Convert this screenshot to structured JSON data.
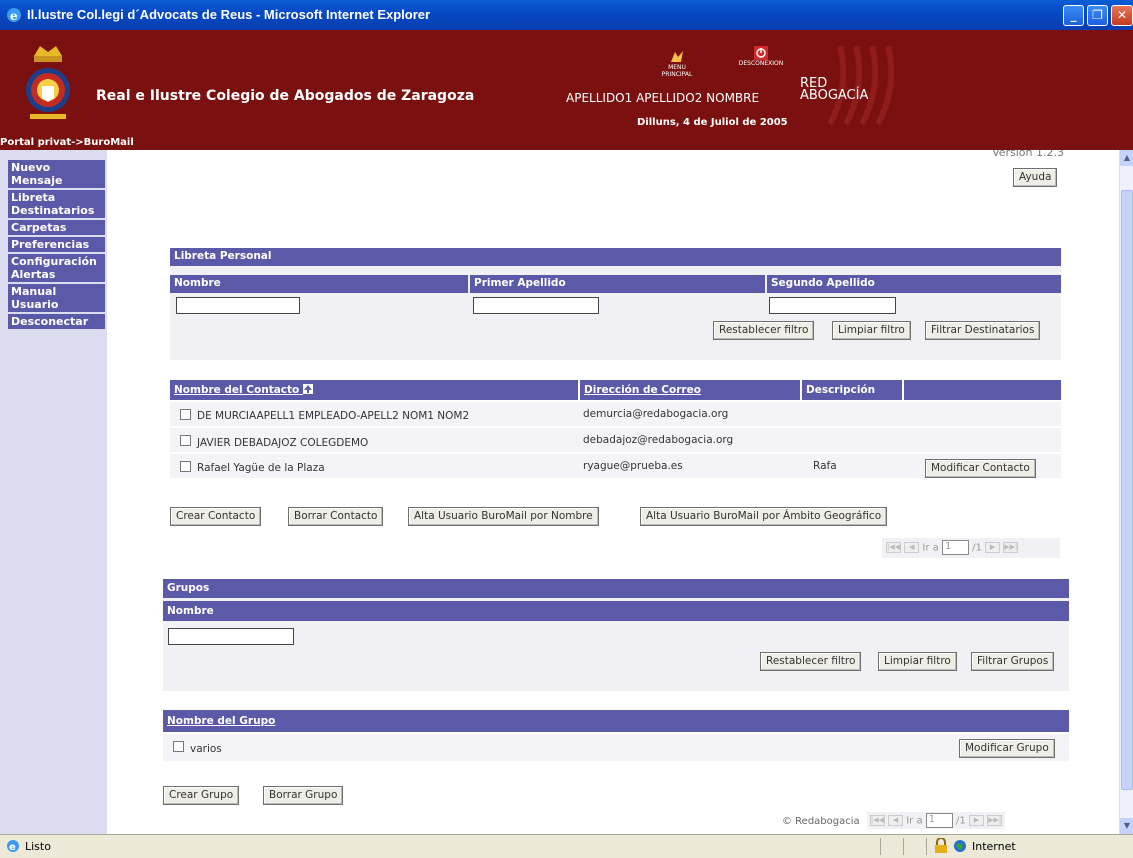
{
  "window": {
    "title": "Il.lustre Col.legi d´Advocats de Reus - Microsoft Internet Explorer",
    "minimize": "_",
    "maximize": "❐",
    "close": "✕"
  },
  "header": {
    "org_title": "Real e Ilustre Colegio de Abogados de Zaragoza",
    "menu_principal": "MENU PRINCIPAL",
    "desconexion": "DESCONEXION",
    "user_name": "APELLIDO1 APELLIDO2  NOMBRE",
    "date": "Dilluns, 4 de Juliol de 2005",
    "logo_line1": "RED",
    "logo_line2": "ABOGACÍA",
    "breadcrumb": "Portal privat->BuroMail"
  },
  "nav": {
    "items": [
      {
        "label": "Nuevo Mensaje"
      },
      {
        "label": "Libreta Destinatarios"
      },
      {
        "label": "Carpetas"
      },
      {
        "label": "Preferencias"
      },
      {
        "label": "Configuración Alertas"
      },
      {
        "label": "Manual Usuario"
      },
      {
        "label": "Desconectar"
      }
    ]
  },
  "content": {
    "version": "Version 1.2.3",
    "ayuda": "Ayuda",
    "libreta": {
      "title": "Libreta Personal",
      "col_nombre": "Nombre",
      "col_primer": "Primer Apellido",
      "col_segundo": "Segundo Apellido",
      "btn_restablecer": "Restablecer filtro",
      "btn_limpiar": "Limpiar filtro",
      "btn_filtrar": "Filtrar Destinatarios"
    },
    "contacts": {
      "col_nombre": "Nombre del Contacto",
      "col_correo": "Dirección de Correo",
      "col_descripcion": "Descripción",
      "rows": [
        {
          "nombre": "DE MURCIAAPELL1 EMPLEADO-APELL2 NOM1 NOM2",
          "correo": "demurcia@redabogacia.org",
          "descripcion": ""
        },
        {
          "nombre": "JAVIER DEBADAJOZ COLEGDEMO",
          "correo": "debadajoz@redabogacia.org",
          "descripcion": ""
        },
        {
          "nombre": "Rafael Yagüe de la Plaza",
          "correo": "ryague@prueba.es",
          "descripcion": "Rafa"
        }
      ],
      "btn_modificar": "Modificar Contacto",
      "btn_crear": "Crear Contacto",
      "btn_borrar": "Borrar Contacto",
      "btn_alta_nombre": "Alta Usuario BuroMail por Nombre",
      "btn_alta_ambito": "Alta Usuario BuroMail por Ámbito Geográfico"
    },
    "pager1": {
      "ir_a": "Ir a",
      "page": "1",
      "total": "/1"
    },
    "grupos": {
      "title": "Grupos",
      "col_nombre": "Nombre",
      "btn_restablecer": "Restablecer filtro",
      "btn_limpiar": "Limpiar filtro",
      "btn_filtrar": "Filtrar Grupos"
    },
    "group_list": {
      "col_nombre": "Nombre del Grupo",
      "rows": [
        {
          "nombre": "varios"
        }
      ],
      "btn_modificar": "Modificar Grupo",
      "btn_crear": "Crear Grupo",
      "btn_borrar": "Borrar Grupo"
    },
    "copyright": "© Redabogacia",
    "pager2": {
      "ir_a": "Ir a",
      "page": "1",
      "total": "/1"
    }
  },
  "status": {
    "text": "Listo",
    "zone": "Internet"
  }
}
